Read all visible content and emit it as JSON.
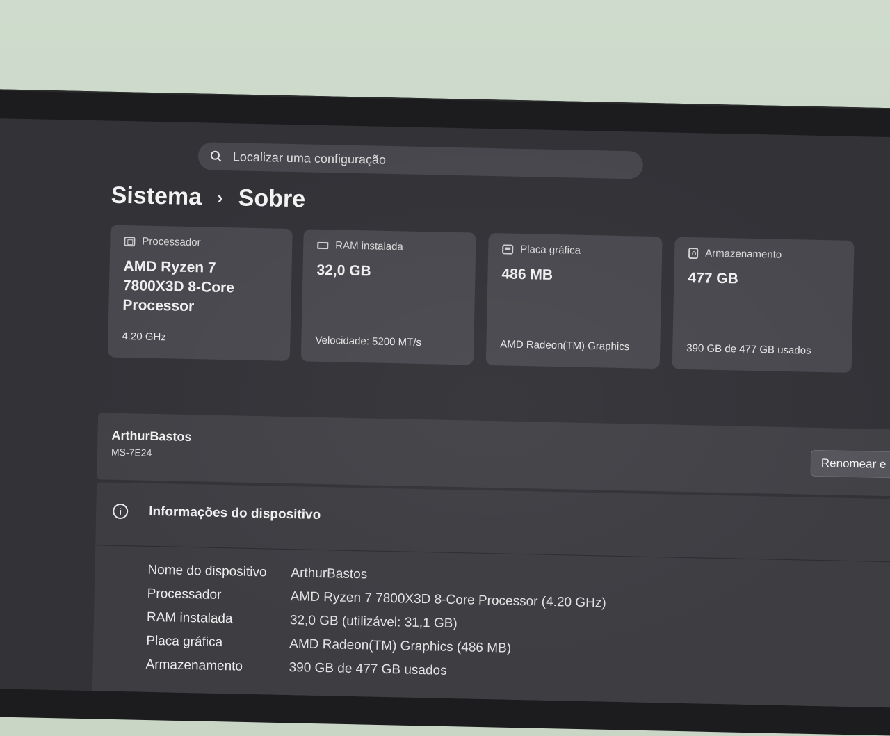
{
  "search": {
    "placeholder": "Localizar uma configuração",
    "icon": "search-icon"
  },
  "breadcrumb": {
    "parent": "Sistema",
    "separator": "›",
    "current": "Sobre"
  },
  "specs": [
    {
      "label": "Processador",
      "value": "AMD Ryzen 7 7800X3D 8-Core Processor",
      "sub": "4.20 GHz",
      "icon": "processor-icon"
    },
    {
      "label": "RAM instalada",
      "value": "32,0 GB",
      "sub": "Velocidade: 5200 MT/s",
      "icon": "ram-icon"
    },
    {
      "label": "Placa gráfica",
      "value": "486 MB",
      "sub": "AMD Radeon(TM) Graphics",
      "icon": "gpu-icon"
    },
    {
      "label": "Armazenamento",
      "value": "477 GB",
      "sub": "390 GB de 477 GB usados",
      "icon": "storage-icon"
    }
  ],
  "device_name": {
    "name": "ArthurBastos",
    "model": "MS-7E24",
    "rename_label": "Renomear e"
  },
  "device_info": {
    "title": "Informações do dispositivo",
    "icon": "info-icon",
    "rows": [
      {
        "label": "Nome do dispositivo",
        "value": "ArthurBastos"
      },
      {
        "label": "Processador",
        "value": "AMD Ryzen 7 7800X3D 8-Core Processor (4.20 GHz)"
      },
      {
        "label": "RAM instalada",
        "value": "32,0 GB (utilizável: 31,1 GB)"
      },
      {
        "label": "Placa gráfica",
        "value": "AMD Radeon(TM) Graphics (486 MB)"
      },
      {
        "label": "Armazenamento",
        "value": "390 GB de 477 GB usados"
      }
    ]
  }
}
